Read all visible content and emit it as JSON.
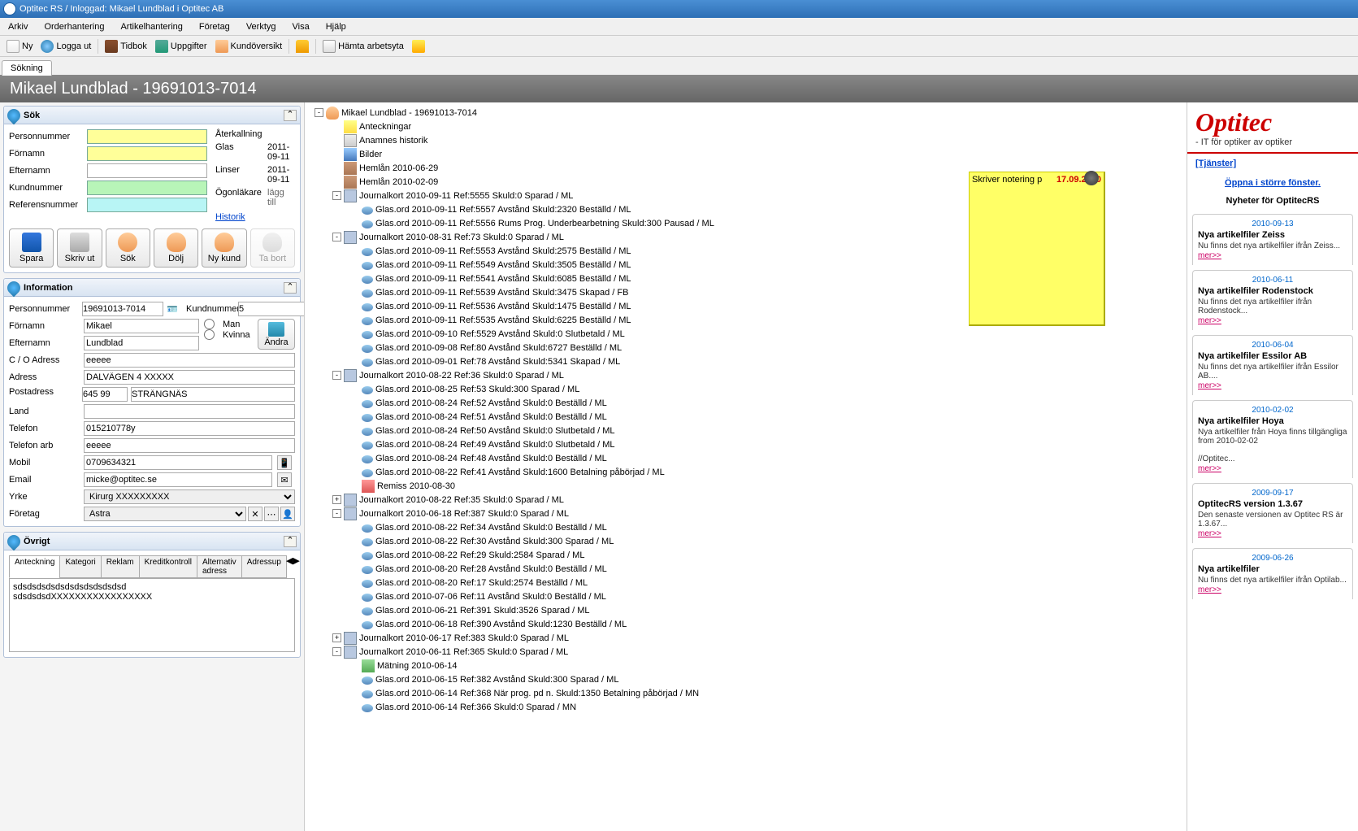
{
  "title": "Optitec RS / Inloggad: Mikael Lundblad i  Optitec AB",
  "menu": [
    "Arkiv",
    "Orderhantering",
    "Artikelhantering",
    "Företag",
    "Verktyg",
    "Visa",
    "Hjälp"
  ],
  "toolbar": [
    {
      "icon": "doc",
      "label": "Ny"
    },
    {
      "icon": "globe",
      "label": "Logga ut"
    },
    {
      "icon": "book",
      "label": "Tidbok"
    },
    {
      "icon": "task",
      "label": "Uppgifter"
    },
    {
      "icon": "user",
      "label": "Kundöversikt"
    },
    {
      "icon": "lock",
      "label": ""
    },
    {
      "icon": "paper",
      "label": "Hämta arbetsyta"
    },
    {
      "icon": "warn",
      "label": ""
    }
  ],
  "tab": "Sökning",
  "header": "Mikael Lundblad - 19691013-7014",
  "search": {
    "title": "Sök",
    "labels": {
      "pn": "Personnummer",
      "fn": "Förnamn",
      "en": "Efternamn",
      "kn": "Kundnummer",
      "rn": "Referensnummer"
    },
    "recall": {
      "title": "Återkallning",
      "glas": "Glas",
      "glas_d": "2011-09-11",
      "linser": "Linser",
      "linser_d": "2011-09-11",
      "ogon": "Ögonläkare",
      "ogon_d": "lägg till",
      "hist": "Historik"
    }
  },
  "buttons": {
    "spara": "Spara",
    "skrivut": "Skriv ut",
    "sok": "Sök",
    "dolj": "Dölj",
    "nykund": "Ny kund",
    "tabort": "Ta bort"
  },
  "info": {
    "title": "Information",
    "labels": {
      "pn": "Personnummer",
      "kn": "Kundnummer",
      "fn": "Förnamn",
      "en": "Efternamn",
      "co": "C / O Adress",
      "adr": "Adress",
      "post": "Postadress",
      "land": "Land",
      "tel": "Telefon",
      "telarb": "Telefon arb",
      "mobil": "Mobil",
      "email": "Email",
      "yrke": "Yrke",
      "foretag": "Företag",
      "man": "Man",
      "kvinna": "Kvinna",
      "andra": "Ändra"
    },
    "vals": {
      "pn": "19691013-7014",
      "kn": "5",
      "fn": "Mikael",
      "en": "Lundblad",
      "co": "eeeee",
      "adr": "DALVÄGEN 4 XXXXX",
      "post1": "645 99",
      "post2": "STRÄNGNÄS",
      "land": "",
      "tel": "015210778y",
      "telarb": "eeeee",
      "mobil": "0709634321",
      "email": "micke@optitec.se",
      "yrke": "Kirurg XXXXXXXXX",
      "foretag": "Astra"
    }
  },
  "ovrigt": {
    "title": "Övrigt",
    "tabs": [
      "Anteckning",
      "Kategori",
      "Reklam",
      "Kreditkontroll",
      "Alternativ adress",
      "Adressup"
    ],
    "text": "sdsdsdsdsdsdsdsdsdsdsdsd\nsdsdsdsdXXXXXXXXXXXXXXXXX"
  },
  "sticky": {
    "text": "Skriver notering p",
    "date": "17.09.2010"
  },
  "tree": [
    {
      "d": 0,
      "e": "-",
      "i": "person",
      "t": "Mikael Lundblad - 19691013-7014"
    },
    {
      "d": 1,
      "e": "",
      "i": "note",
      "t": "Anteckningar"
    },
    {
      "d": 1,
      "e": "",
      "i": "hist",
      "t": "Anamnes historik"
    },
    {
      "d": 1,
      "e": "",
      "i": "pic",
      "t": "Bilder"
    },
    {
      "d": 1,
      "e": "",
      "i": "loan",
      "t": "Hemlån  2010-06-29"
    },
    {
      "d": 1,
      "e": "",
      "i": "loan",
      "t": "Hemlån  2010-02-09"
    },
    {
      "d": 1,
      "e": "-",
      "i": "journal",
      "t": "Journalkort  2010-09-11 Ref:5555 Skuld:0 Sparad / ML"
    },
    {
      "d": 2,
      "e": "",
      "i": "glas",
      "t": "Glas.ord  2010-09-11 Ref:5557 Avstånd Skuld:2320 Beställd / ML"
    },
    {
      "d": 2,
      "e": "",
      "i": "glas",
      "t": "Glas.ord  2010-09-11 Ref:5556 Rums Prog. Underbearbetning Skuld:300 Pausad / ML"
    },
    {
      "d": 1,
      "e": "-",
      "i": "journal",
      "t": "Journalkort  2010-08-31 Ref:73 Skuld:0 Sparad / ML"
    },
    {
      "d": 2,
      "e": "",
      "i": "glas",
      "t": "Glas.ord  2010-09-11 Ref:5553 Avstånd Skuld:2575 Beställd / ML"
    },
    {
      "d": 2,
      "e": "",
      "i": "glas",
      "t": "Glas.ord  2010-09-11 Ref:5549 Avstånd Skuld:3505 Beställd / ML"
    },
    {
      "d": 2,
      "e": "",
      "i": "glas",
      "t": "Glas.ord  2010-09-11 Ref:5541 Avstånd Skuld:6085 Beställd / ML"
    },
    {
      "d": 2,
      "e": "",
      "i": "glas",
      "t": "Glas.ord  2010-09-11 Ref:5539 Avstånd Skuld:3475 Skapad / FB"
    },
    {
      "d": 2,
      "e": "",
      "i": "glas",
      "t": "Glas.ord  2010-09-11 Ref:5536 Avstånd Skuld:1475 Beställd / ML"
    },
    {
      "d": 2,
      "e": "",
      "i": "glas",
      "t": "Glas.ord  2010-09-11 Ref:5535 Avstånd Skuld:6225 Beställd / ML"
    },
    {
      "d": 2,
      "e": "",
      "i": "glas",
      "t": "Glas.ord  2010-09-10 Ref:5529 Avstånd Skuld:0 Slutbetald / ML"
    },
    {
      "d": 2,
      "e": "",
      "i": "glas",
      "t": "Glas.ord  2010-09-08 Ref:80 Avstånd Skuld:6727 Beställd / ML"
    },
    {
      "d": 2,
      "e": "",
      "i": "glas",
      "t": "Glas.ord  2010-09-01 Ref:78 Avstånd Skuld:5341 Skapad / ML"
    },
    {
      "d": 1,
      "e": "-",
      "i": "journal",
      "t": "Journalkort  2010-08-22 Ref:36 Skuld:0 Sparad / ML"
    },
    {
      "d": 2,
      "e": "",
      "i": "glas",
      "t": "Glas.ord  2010-08-25 Ref:53 Skuld:300 Sparad / ML"
    },
    {
      "d": 2,
      "e": "",
      "i": "glas",
      "t": "Glas.ord  2010-08-24 Ref:52 Avstånd Skuld:0 Beställd / ML"
    },
    {
      "d": 2,
      "e": "",
      "i": "glas",
      "t": "Glas.ord  2010-08-24 Ref:51 Avstånd Skuld:0 Beställd / ML"
    },
    {
      "d": 2,
      "e": "",
      "i": "glas",
      "t": "Glas.ord  2010-08-24 Ref:50 Avstånd Skuld:0 Slutbetald / ML"
    },
    {
      "d": 2,
      "e": "",
      "i": "glas",
      "t": "Glas.ord  2010-08-24 Ref:49 Avstånd Skuld:0 Slutbetald / ML"
    },
    {
      "d": 2,
      "e": "",
      "i": "glas",
      "t": "Glas.ord  2010-08-24 Ref:48 Avstånd Skuld:0 Beställd / ML"
    },
    {
      "d": 2,
      "e": "",
      "i": "glas",
      "t": "Glas.ord  2010-08-22 Ref:41 Avstånd Skuld:1600 Betalning påbörjad / ML"
    },
    {
      "d": 2,
      "e": "",
      "i": "remiss",
      "t": "Remiss  2010-08-30"
    },
    {
      "d": 1,
      "e": "+",
      "i": "journal",
      "t": "Journalkort  2010-08-22 Ref:35 Skuld:0 Sparad / ML"
    },
    {
      "d": 1,
      "e": "-",
      "i": "journal",
      "t": "Journalkort  2010-06-18 Ref:387 Skuld:0 Sparad / ML"
    },
    {
      "d": 2,
      "e": "",
      "i": "glas",
      "t": "Glas.ord  2010-08-22 Ref:34 Avstånd Skuld:0 Beställd / ML"
    },
    {
      "d": 2,
      "e": "",
      "i": "glas",
      "t": "Glas.ord  2010-08-22 Ref:30 Avstånd Skuld:300 Sparad / ML"
    },
    {
      "d": 2,
      "e": "",
      "i": "glas",
      "t": "Glas.ord  2010-08-22 Ref:29 Skuld:2584 Sparad / ML"
    },
    {
      "d": 2,
      "e": "",
      "i": "glas",
      "t": "Glas.ord  2010-08-20 Ref:28 Avstånd Skuld:0 Beställd / ML"
    },
    {
      "d": 2,
      "e": "",
      "i": "glas",
      "t": "Glas.ord  2010-08-20 Ref:17 Skuld:2574 Beställd / ML"
    },
    {
      "d": 2,
      "e": "",
      "i": "glas",
      "t": "Glas.ord  2010-07-06 Ref:11 Avstånd Skuld:0 Beställd / ML"
    },
    {
      "d": 2,
      "e": "",
      "i": "glas",
      "t": "Glas.ord  2010-06-21 Ref:391 Skuld:3526 Sparad / ML"
    },
    {
      "d": 2,
      "e": "",
      "i": "glas",
      "t": "Glas.ord  2010-06-18 Ref:390 Avstånd Skuld:1230 Beställd / ML"
    },
    {
      "d": 1,
      "e": "+",
      "i": "journal",
      "t": "Journalkort  2010-06-17 Ref:383 Skuld:0 Sparad / ML"
    },
    {
      "d": 1,
      "e": "-",
      "i": "journal",
      "t": "Journalkort  2010-06-11 Ref:365 Skuld:0 Sparad / ML"
    },
    {
      "d": 2,
      "e": "",
      "i": "meas",
      "t": "Mätning  2010-06-14"
    },
    {
      "d": 2,
      "e": "",
      "i": "glas",
      "t": "Glas.ord  2010-06-15 Ref:382 Avstånd Skuld:300 Sparad / ML"
    },
    {
      "d": 2,
      "e": "",
      "i": "glas",
      "t": "Glas.ord  2010-06-14 Ref:368 När prog. pd n. Skuld:1350 Betalning påbörjad / MN"
    },
    {
      "d": 2,
      "e": "",
      "i": "glas",
      "t": "Glas.ord  2010-06-14 Ref:366 Skuld:0 Sparad / MN"
    }
  ],
  "right": {
    "logo": "Optitec",
    "tag": "- IT för optiker av optiker",
    "tjanster": "[Tjänster]",
    "oppna": "Öppna i större fönster.",
    "nyheter": "Nyheter för OptitecRS",
    "items": [
      {
        "date": "2010-09-13",
        "title": "Nya artikelfiler Zeiss",
        "body": "Nu finns det nya artikelfiler ifrån Zeiss...",
        "more": "mer>>"
      },
      {
        "date": "2010-06-11",
        "title": "Nya artikelfiler Rodenstock",
        "body": "Nu finns det nya artikelfiler ifrån Rodenstock...",
        "more": "mer>>"
      },
      {
        "date": "2010-06-04",
        "title": "Nya artikelfiler Essilor AB",
        "body": "Nu finns det nya artikelfiler ifrån Essilor AB....",
        "more": "mer>>"
      },
      {
        "date": "2010-02-02",
        "title": "Nya artikelfiler Hoya",
        "body": "Nya artikelfiler från Hoya finns tillgängliga from 2010-02-02\n\n//Optitec...",
        "more": "mer>>"
      },
      {
        "date": "2009-09-17",
        "title": "OptitecRS version 1.3.67",
        "body": "Den senaste versionen av Optitec RS är 1.3.67...",
        "more": "mer>>"
      },
      {
        "date": "2009-06-26",
        "title": "Nya artikelfiler",
        "body": "Nu finns det nya artikelfiler ifrån Optilab...",
        "more": "mer>>"
      }
    ]
  }
}
